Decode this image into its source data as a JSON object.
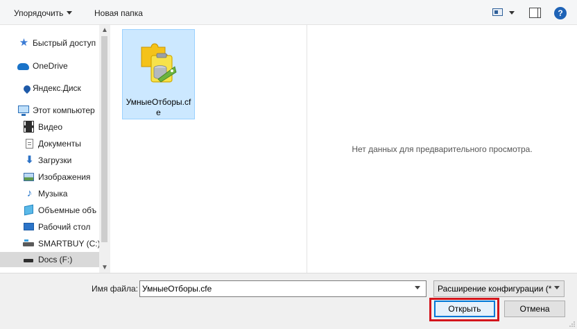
{
  "toolbar": {
    "organize_label": "Упорядочить",
    "new_folder_label": "Новая папка",
    "help_label": "?"
  },
  "nav": {
    "items": [
      {
        "label": "Быстрый доступ",
        "icon": "star-icon"
      },
      {
        "label": "OneDrive",
        "icon": "cloud-icon"
      },
      {
        "label": "Яндекс.Диск",
        "icon": "yandex-disk-icon"
      },
      {
        "label": "Этот компьютер",
        "icon": "computer-icon"
      },
      {
        "label": "Видео",
        "icon": "video-icon"
      },
      {
        "label": "Документы",
        "icon": "documents-icon"
      },
      {
        "label": "Загрузки",
        "icon": "downloads-icon"
      },
      {
        "label": "Изображения",
        "icon": "pictures-icon"
      },
      {
        "label": "Музыка",
        "icon": "music-icon"
      },
      {
        "label": "Объемные объ",
        "icon": "3d-objects-icon"
      },
      {
        "label": "Рабочий стол",
        "icon": "desktop-icon"
      },
      {
        "label": "SMARTBUY (C:)",
        "icon": "drive-icon"
      },
      {
        "label": "Docs (F:)",
        "icon": "usb-drive-icon",
        "selected": true
      }
    ]
  },
  "files": {
    "items": [
      {
        "name": "УмныеОтборы.cfe",
        "icon": "configuration-extension-icon",
        "selected": true
      }
    ]
  },
  "preview": {
    "empty_text": "Нет данных для предварительного просмотра."
  },
  "bottom": {
    "filename_label": "Имя файла:",
    "filename_value": "УмныеОтборы.cfe",
    "filetype_value": "Расширение конфигурации (*",
    "open_label": "Открыть",
    "cancel_label": "Отмена"
  },
  "colors": {
    "accent": "#0078d7",
    "highlight": "#d3151c",
    "selection": "#cce8ff"
  }
}
